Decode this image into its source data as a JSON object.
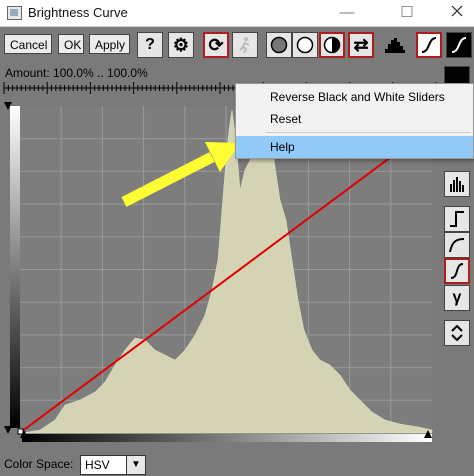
{
  "window": {
    "title": "Brightness Curve",
    "minimize": "—",
    "maximize": "☐"
  },
  "toolbar": {
    "cancel_label": "Cancel",
    "ok_label": "OK",
    "apply_label": "Apply",
    "help_glyph": "?",
    "settings_glyph": "⚙",
    "refresh_glyph": "⟳",
    "swap_glyph": "⇄"
  },
  "amount": {
    "text": "Amount: 100.0% .. 100.0%"
  },
  "color_space": {
    "label": "Color Space:",
    "value": "HSV"
  },
  "context_menu": {
    "items": [
      "Reverse Black and White Sliders",
      "Reset",
      "Help"
    ],
    "highlighted": "Help"
  },
  "right_panel": {
    "gamma_glyph": "γ"
  },
  "colors": {
    "accent_red": "#b01c1c",
    "histogram": "#d4d4b4",
    "curve": "#e00000",
    "arrow": "#ffff33",
    "menu_highlight": "#91c9f7"
  },
  "icons": [
    "app-icon",
    "help-icon",
    "gear-icon",
    "refresh-icon",
    "running-figure-icon",
    "circle-dark-icon",
    "circle-light-icon",
    "half-circle-icon",
    "swap-icon",
    "histogram-icon",
    "s-curve-icon",
    "step-curve-icon",
    "log-curve-icon",
    "gamma-icon",
    "up-down-icon"
  ]
}
